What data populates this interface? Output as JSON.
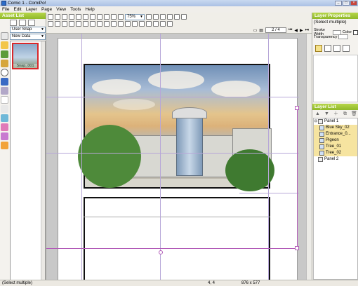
{
  "window": {
    "title": "Comic 1 - ComiPo!"
  },
  "menu": [
    "File",
    "Edit",
    "Layer",
    "Page",
    "View",
    "Tools",
    "Help"
  ],
  "asset_panel": {
    "header": "Asset List",
    "dropdown1": "User Snap",
    "dropdown2": "New Data",
    "thumb_label": "Snap_001"
  },
  "toolbar": {
    "zoom": "75%",
    "page_indicator": "2 / 4"
  },
  "properties": {
    "header": "Layer Properties",
    "selection": "(Select multiple)",
    "stroke_width_label": "Stroke Width",
    "transparency_label": "Transparency",
    "color_label": "Color"
  },
  "layer_list": {
    "header": "Layer List",
    "items": [
      {
        "label": "Panel 1",
        "level": 0
      },
      {
        "label": "Blue Sky_02",
        "level": 1
      },
      {
        "label": "Entrance_0...",
        "level": 1
      },
      {
        "label": "Pigeon",
        "level": 1
      },
      {
        "label": "Tree_01",
        "level": 1
      },
      {
        "label": "Tree_02",
        "level": 1
      },
      {
        "label": "Panel 2",
        "level": 0
      }
    ]
  },
  "statusbar": {
    "left": "(Select multiple)",
    "coords": "4, 4",
    "size": "876 x 577"
  }
}
